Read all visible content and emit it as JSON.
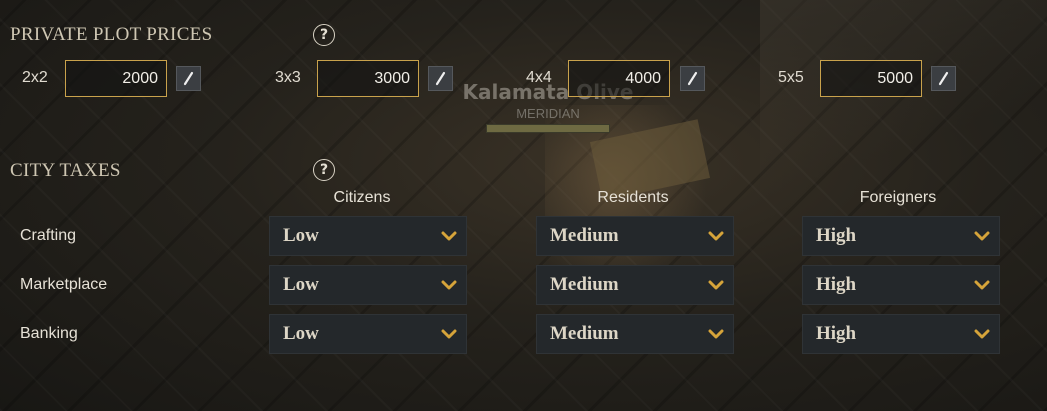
{
  "scene": {
    "character_name": "Kalamata Olive",
    "guild_name": "MERIDIAN"
  },
  "plot_prices": {
    "title": "PRIVATE PLOT PRICES",
    "help_icon_glyph": "?",
    "items": [
      {
        "size": "2x2",
        "value": "2000"
      },
      {
        "size": "3x3",
        "value": "3000"
      },
      {
        "size": "4x4",
        "value": "4000"
      },
      {
        "size": "5x5",
        "value": "5000"
      }
    ],
    "edit_icon": "pencil-icon"
  },
  "city_taxes": {
    "title": "CITY TAXES",
    "help_icon_glyph": "?",
    "columns": [
      "Citizens",
      "Residents",
      "Foreigners"
    ],
    "rows": [
      {
        "label": "Crafting",
        "values": [
          "Low",
          "Medium",
          "High"
        ]
      },
      {
        "label": "Marketplace",
        "values": [
          "Low",
          "Medium",
          "High"
        ]
      },
      {
        "label": "Banking",
        "values": [
          "Low",
          "Medium",
          "High"
        ]
      }
    ],
    "dropdown_icon": "chevron-down-icon"
  },
  "colors": {
    "accent_gold": "#c9a24c",
    "dropdown_bg": "#24282b",
    "edit_button_bg": "#3b3e42"
  }
}
